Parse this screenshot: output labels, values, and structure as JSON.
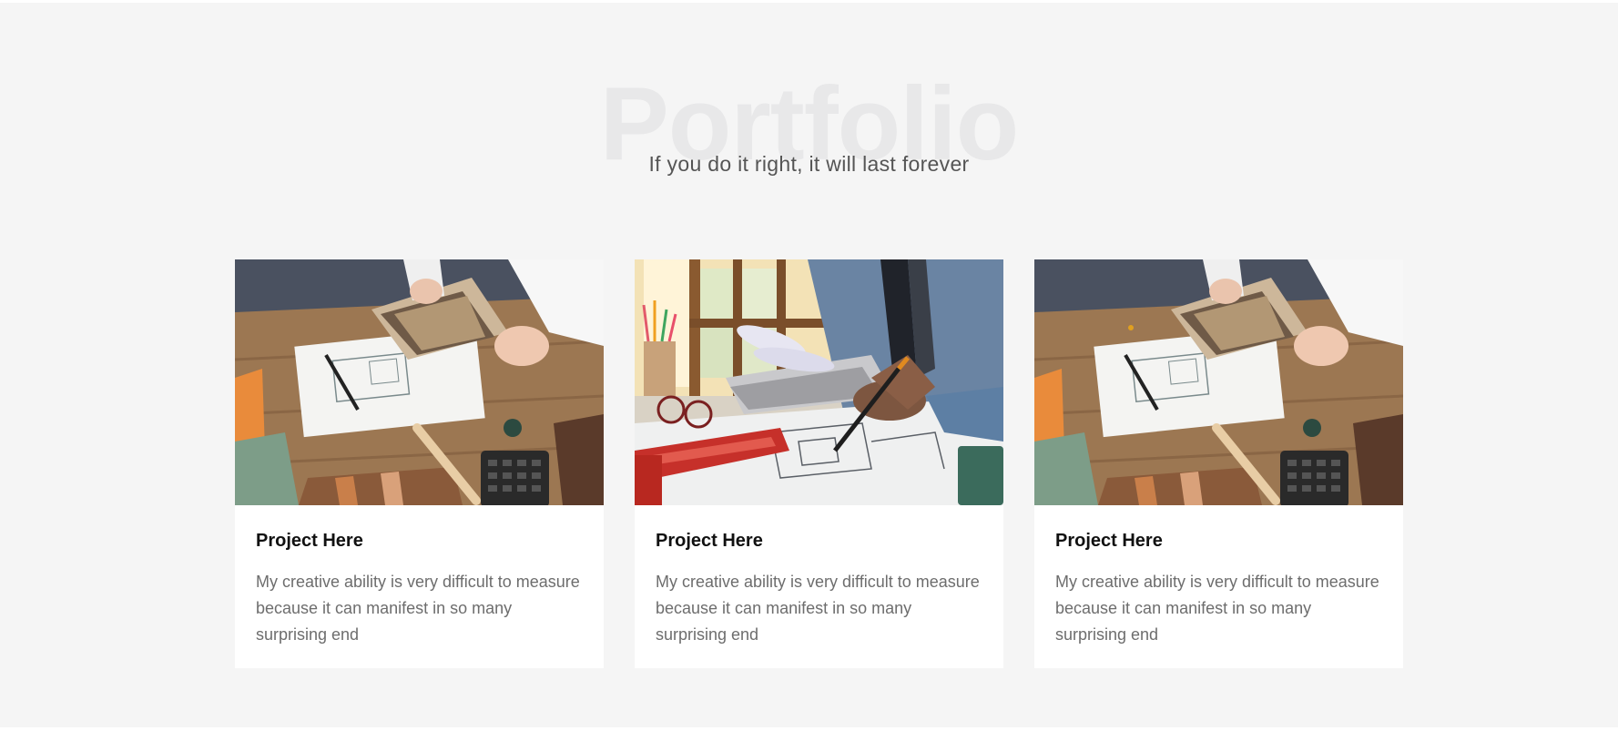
{
  "portfolio": {
    "title": "Portfolio",
    "subtitle": "If you do it right, it will last forever",
    "cards": [
      {
        "image": "interior-samples-photo",
        "title": "Project Here",
        "description": "My creative ability is very difficult to measure because it can manifest in so many surprising end"
      },
      {
        "image": "architect-blueprint-photo",
        "title": "Project Here",
        "description": "My creative ability is very difficult to measure because it can manifest in so many surprising end"
      },
      {
        "image": "interior-samples-photo",
        "title": "Project Here",
        "description": "My creative ability is very difficult to measure because it can manifest in so many surprising end"
      }
    ]
  }
}
